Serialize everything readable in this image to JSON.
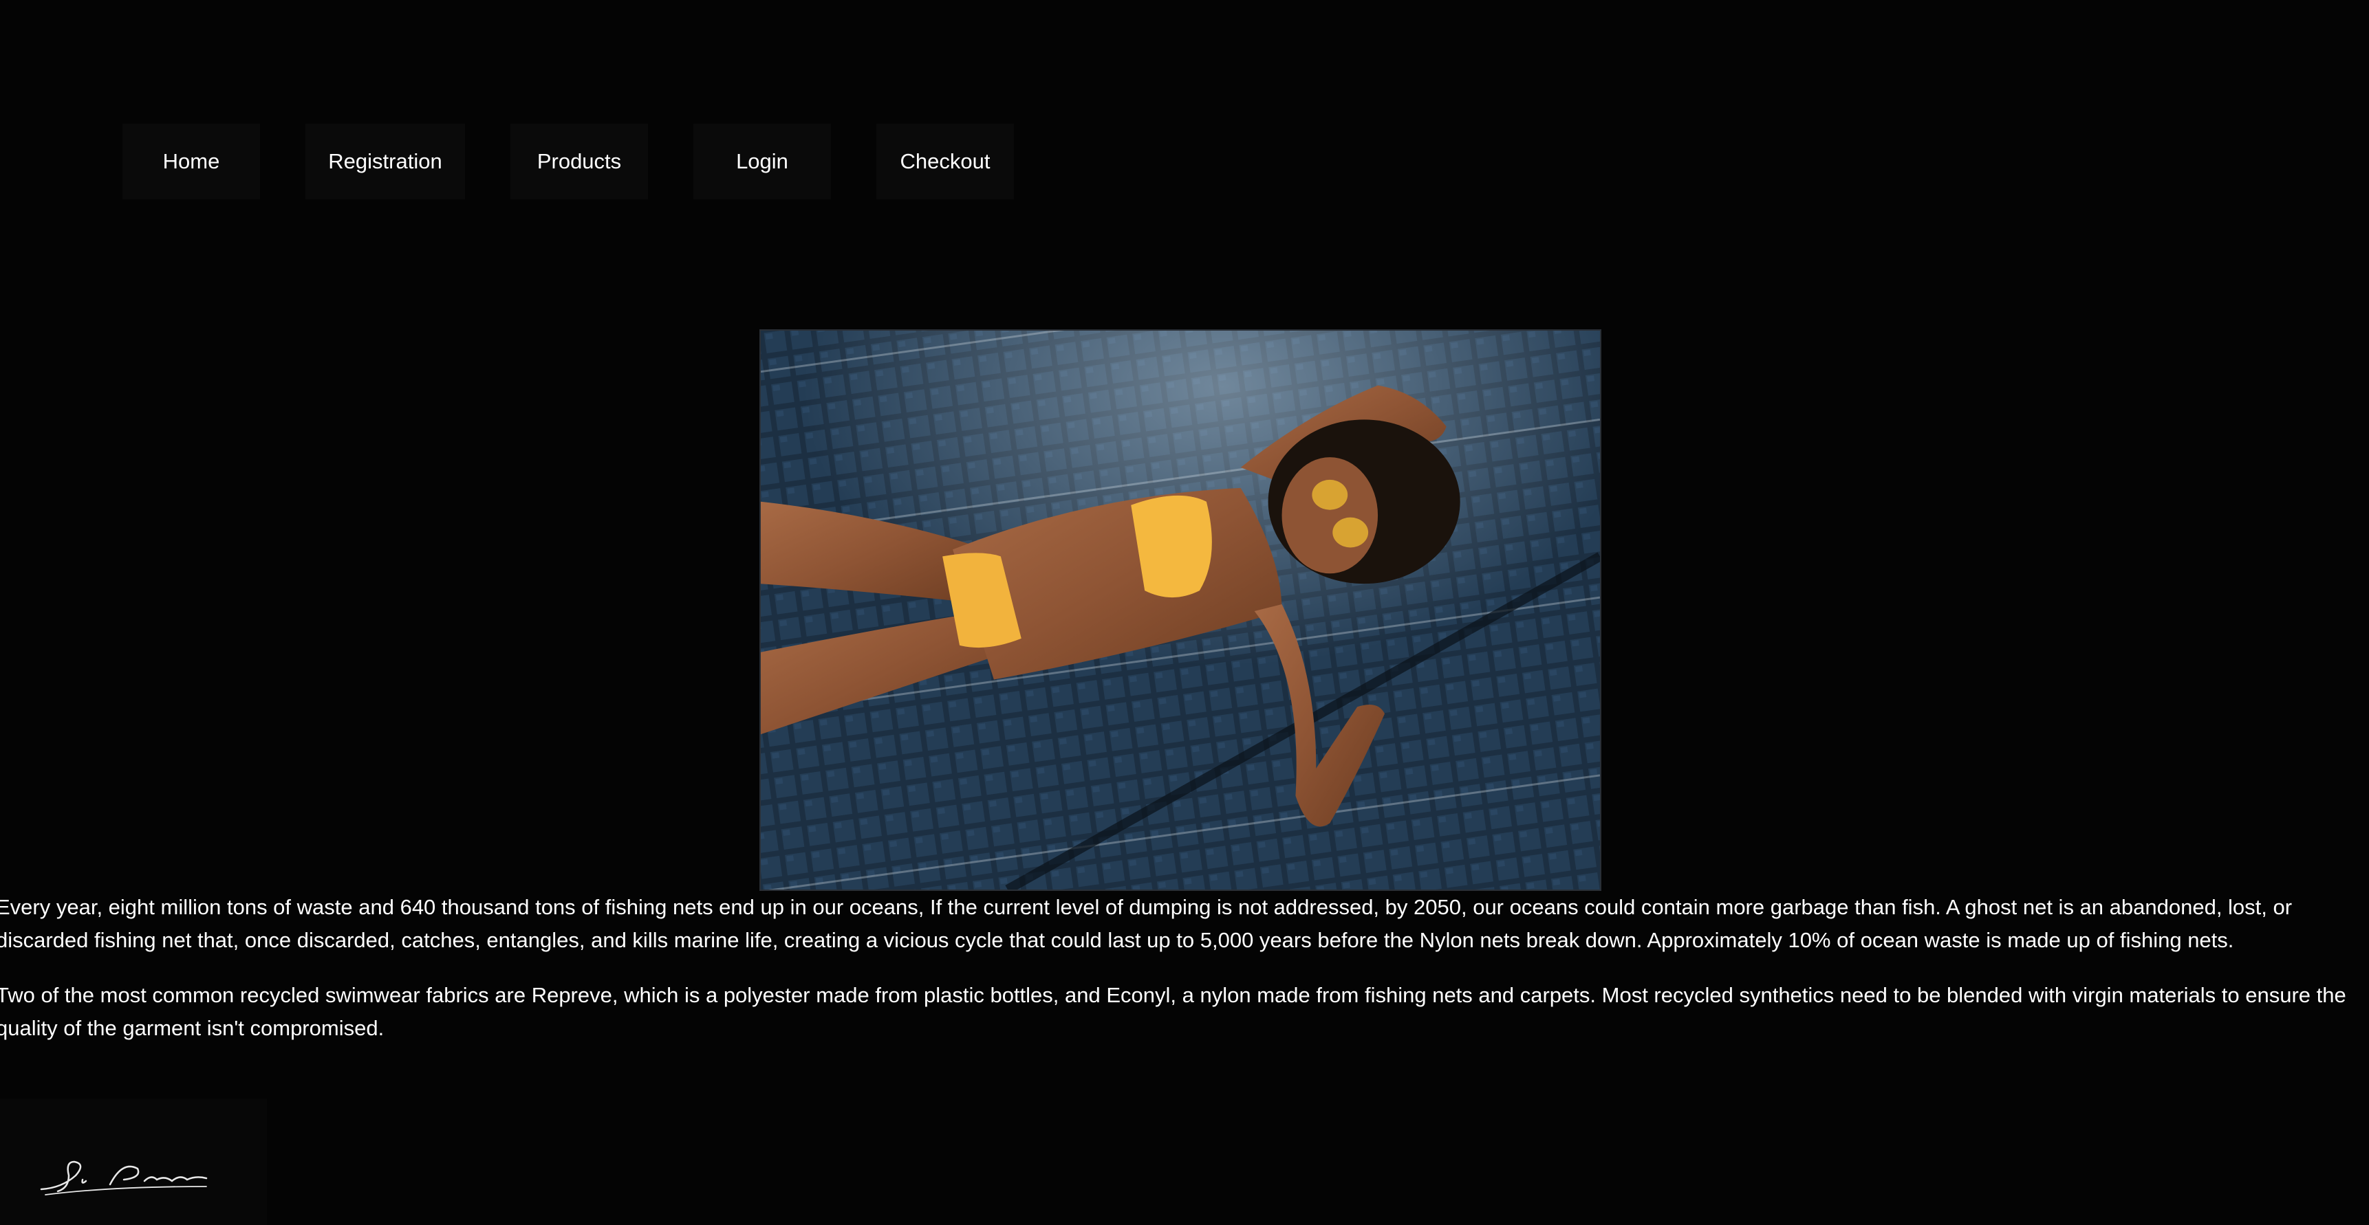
{
  "nav": {
    "items": [
      {
        "label": "Home"
      },
      {
        "label": "Registration"
      },
      {
        "label": "Products"
      },
      {
        "label": "Login"
      },
      {
        "label": "Checkout"
      }
    ]
  },
  "hero": {
    "image_subject": "woman in yellow bikini and sunglasses lying on pool tile grid"
  },
  "content": {
    "paragraph_1": "Every year, eight million tons of waste and 640 thousand tons of fishing nets end up in our oceans, If the current level of dumping is not addressed, by 2050, our oceans could contain more garbage than fish. A ghost net is an abandoned, lost, or discarded fishing net that, once discarded, catches, entangles, and kills marine life, creating a vicious cycle that could last up to 5,000 years before the Nylon nets break down. Approximately 10% of ocean waste is made up of fishing nets.",
    "paragraph_2": "Two of the most common recycled swimwear fabrics are Repreve, which is a polyester made from plastic bottles, and Econyl, a nylon made from fishing nets and carpets. Most recycled synthetics need to be blended with virgin materials to ensure the quality of the garment isn't compromised."
  },
  "footer": {
    "signature_text": "P. Pierre"
  },
  "colors": {
    "background": "#040404",
    "nav_bg": "#0a0a0a",
    "text": "#ffffff",
    "pool_tile": "#1f3447",
    "bikini": "#f2b33d"
  }
}
